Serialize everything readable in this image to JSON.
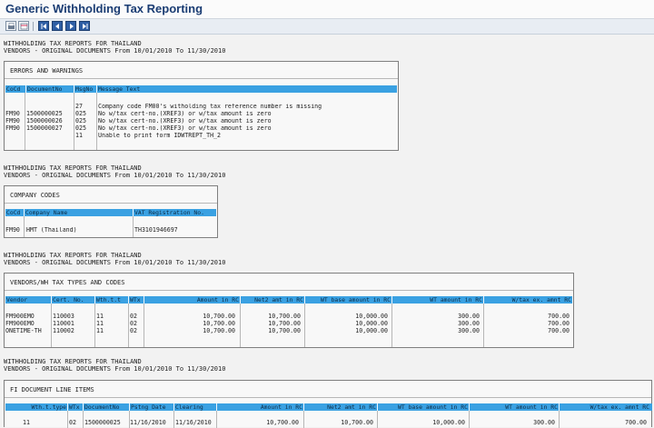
{
  "title": "Generic Withholding Tax Reporting",
  "toolbar": {
    "icons": [
      "print-icon",
      "layout-icon",
      "first-page-icon",
      "previous-page-icon",
      "next-page-icon",
      "last-page-icon"
    ]
  },
  "report_header": {
    "line1": "WITHHOLDING TAX REPORTS FOR THAILAND",
    "line2": "VENDORS - ORIGINAL DOCUMENTS From 10/01/2010 To 11/30/2010"
  },
  "errors": {
    "title": "ERRORS AND WARNINGS",
    "columns": [
      "CoCd",
      "DocumentNo",
      "MsgNo",
      "Message Text"
    ],
    "rows": [
      [
        "",
        "",
        "27",
        "Company code FM00's witholding tax reference number is missing"
      ],
      [
        "FM90",
        "1500000025",
        "025",
        "No w/tax cert-no.(XREF3) or w/tax amount is zero"
      ],
      [
        "FM90",
        "1500000026",
        "025",
        "No w/tax cert-no.(XREF3) or w/tax amount is zero"
      ],
      [
        "FM90",
        "1500000027",
        "025",
        "No w/tax cert-no.(XREF3) or w/tax amount is zero"
      ],
      [
        "",
        "",
        "11",
        "Unable to print form IDWTREPT_TH_2"
      ]
    ]
  },
  "company_codes": {
    "title": "COMPANY CODES",
    "columns": [
      "CoCd",
      "Company Name",
      "VAT Registration No."
    ],
    "rows": [
      [
        "FM90",
        "HMT (Thailand)",
        "TH3101946697"
      ]
    ]
  },
  "vendors": {
    "title": "VENDORS/WH TAX TYPES AND CODES",
    "columns": [
      "Vendor",
      "Cert. No.",
      "Wth.t.t",
      "WTx",
      "Amount in RC",
      "Net2 amt in RC",
      "WT base amount in RC",
      "WT amount in RC",
      "W/tax ex. amnt RC"
    ],
    "rows": [
      [
        "FM900EMO",
        "110003",
        "11",
        "02",
        "10,700.00",
        "10,700.00",
        "10,000.00",
        "300.00",
        "700.00"
      ],
      [
        "FM900EMO",
        "110001",
        "11",
        "02",
        "10,700.00",
        "10,700.00",
        "10,000.00",
        "300.00",
        "700.00"
      ],
      [
        "ONETIME-TH",
        "110002",
        "11",
        "02",
        "10,700.00",
        "10,700.00",
        "10,000.00",
        "300.00",
        "700.00"
      ]
    ]
  },
  "fi_items": {
    "title": "FI DOCUMENT LINE ITEMS",
    "columns": [
      "Wth.t.type",
      "WTx",
      "DocumentNo",
      "Pstng Date",
      "Clearing",
      "Amount in RC",
      "Net2 amt in RC",
      "WT base amount in RC",
      "WT amount in RC",
      "W/tax ex. amnt RC"
    ],
    "rows": [
      [
        "11",
        "02",
        "1500000025",
        "11/16/2010",
        "11/16/2010",
        "10,700.00",
        "10,700.00",
        "10,000.00",
        "300.00",
        "700.00"
      ]
    ]
  },
  "colors": {
    "header_blue": "#3aa1e2",
    "title_navy": "#1b3d73"
  }
}
